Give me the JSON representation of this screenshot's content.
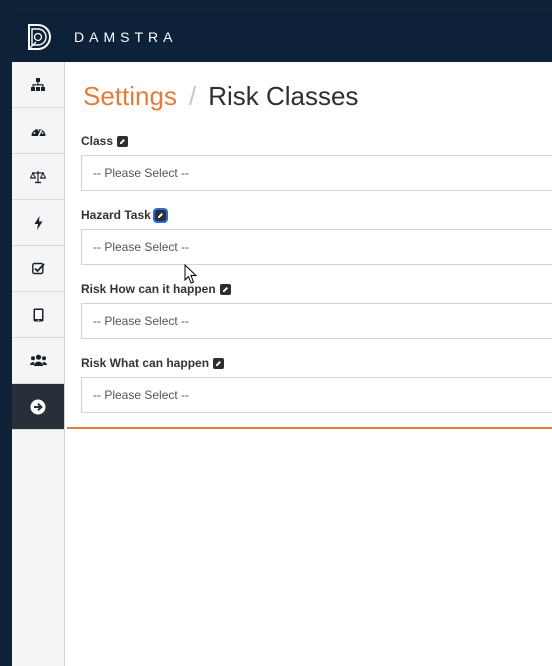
{
  "header": {
    "brand": "DAMSTRA"
  },
  "sidebar": {
    "items": [
      {
        "icon": "sitemap-icon"
      },
      {
        "icon": "dashboard-icon"
      },
      {
        "icon": "balance-scale-icon"
      },
      {
        "icon": "bolt-icon"
      },
      {
        "icon": "checkbox-icon"
      },
      {
        "icon": "tablet-icon"
      },
      {
        "icon": "users-icon"
      },
      {
        "icon": "arrow-right-circle-icon",
        "active": true
      }
    ]
  },
  "breadcrumb": {
    "root": "Settings",
    "separator": "/",
    "current": "Risk Classes"
  },
  "fields": [
    {
      "label": "Class",
      "placeholder": "-- Please Select --"
    },
    {
      "label": "Hazard Task",
      "placeholder": "-- Please Select --"
    },
    {
      "label": "Risk How can it happen",
      "placeholder": "-- Please Select --"
    },
    {
      "label": "Risk What can happen",
      "placeholder": "-- Please Select --"
    }
  ],
  "colors": {
    "accent": "#e47c3a",
    "topbar": "#0d2138",
    "sidebar_active": "#273038"
  }
}
